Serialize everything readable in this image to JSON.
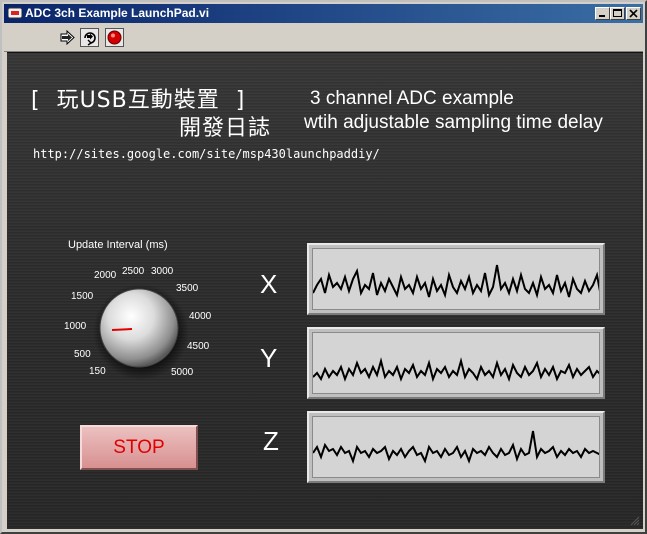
{
  "window": {
    "title": "ADC 3ch Example LaunchPad.vi",
    "icon": "labview-vi-icon",
    "controls": [
      "minimize-icon",
      "maximize-icon",
      "close-icon"
    ]
  },
  "toolbar": {
    "buttons": [
      "run-arrow-icon",
      "run-continuously-icon",
      "abort-icon"
    ]
  },
  "header": {
    "zh_line1": "[  玩USB互動裝置  ]",
    "zh_line2": "開發日誌",
    "en_line1": "3 channel ADC example",
    "en_line2": "wtih adjustable sampling time delay",
    "url": "http://sites.google.com/site/msp430launchpaddiy/"
  },
  "knob": {
    "label": "Update Interval (ms)",
    "ticks": [
      "150",
      "500",
      "1000",
      "1500",
      "2000",
      "2500",
      "3000",
      "3500",
      "4000",
      "4500",
      "5000"
    ],
    "value": 1000,
    "indicator_color": "#e00000"
  },
  "charts": {
    "x_label": "X",
    "y_label": "Y",
    "z_label": "Z"
  },
  "stop_button": {
    "label": "STOP",
    "text_color": "#e00000"
  },
  "colors": {
    "titlebar_start": "#0a246a",
    "titlebar_end": "#3a6ea5",
    "panel_bg": "#2d2d2d",
    "graph_bg": "#d4d4d4",
    "trace": "#000000"
  }
}
